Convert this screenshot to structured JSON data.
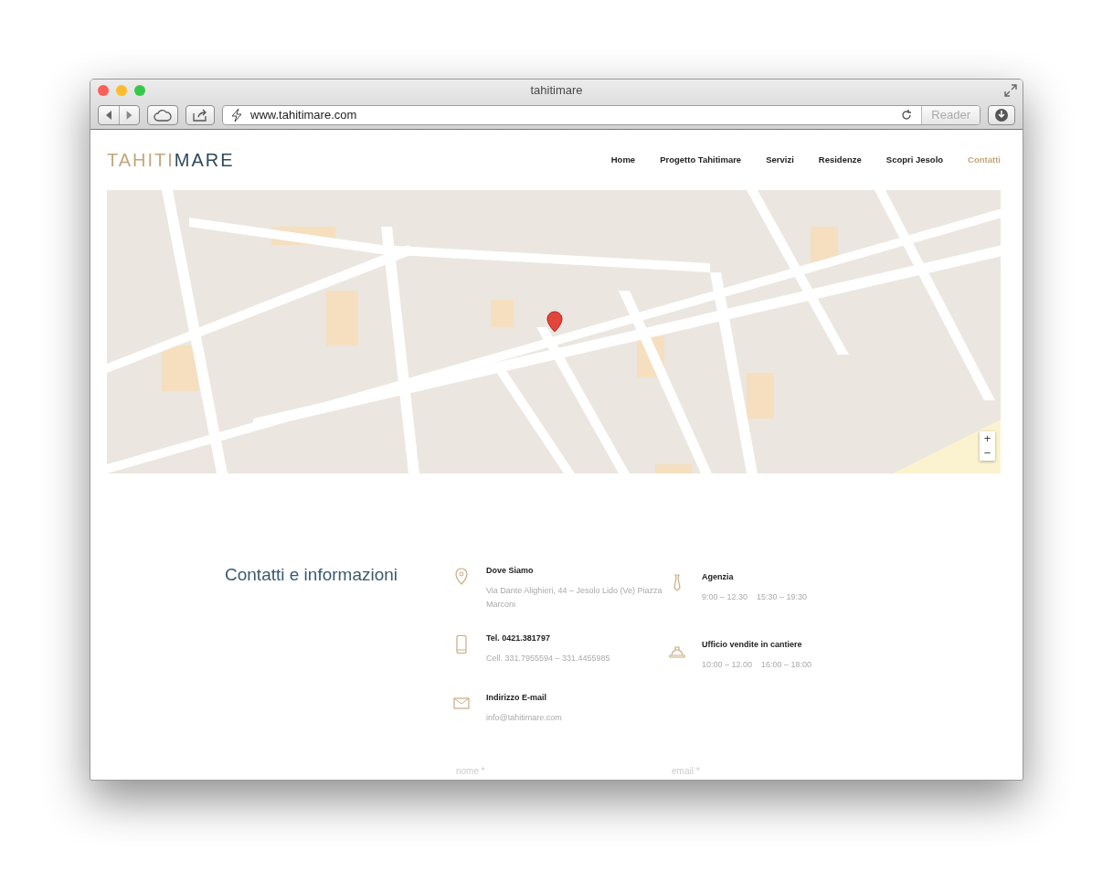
{
  "window": {
    "title": "tahitimare"
  },
  "toolbar": {
    "url": "www.tahitimare.com",
    "reader": "Reader"
  },
  "logo": {
    "accent": "TAHITI",
    "main": "MARE"
  },
  "nav": [
    {
      "label": "Home",
      "selected": false
    },
    {
      "label": "Progetto Tahitimare",
      "selected": false
    },
    {
      "label": "Servizi",
      "selected": false
    },
    {
      "label": "Residenze",
      "selected": false
    },
    {
      "label": "Scopri Jesolo",
      "selected": false
    },
    {
      "label": "Contatti",
      "selected": true
    }
  ],
  "map": {
    "zoom_in": "+",
    "zoom_out": "−"
  },
  "contacts": {
    "title": "Contatti e informazioni",
    "items": [
      {
        "kind": "pin",
        "heading": "Dove Siamo",
        "detail": "Via Dante Alighieri, 44 – Jesolo Lido (Ve) Piazza Marconi"
      },
      {
        "kind": "tie",
        "heading": "Agenzia",
        "detail": "9:00 – 12.30    15:30 – 19:30"
      },
      {
        "kind": "phone",
        "heading": "Tel. 0421.381797",
        "detail": "Cell. 331.7955594 – 331.4455985"
      },
      {
        "kind": "helmet",
        "heading": "Ufficio vendite in cantiere",
        "detail": "10:00 – 12.00    16:00 – 18:00"
      },
      {
        "kind": "mail",
        "heading": "Indirizzo E-mail",
        "detail": "info@tahitimare.com"
      }
    ]
  },
  "form": {
    "fields": [
      {
        "placeholder": "nome *"
      },
      {
        "placeholder": "email *"
      }
    ]
  }
}
